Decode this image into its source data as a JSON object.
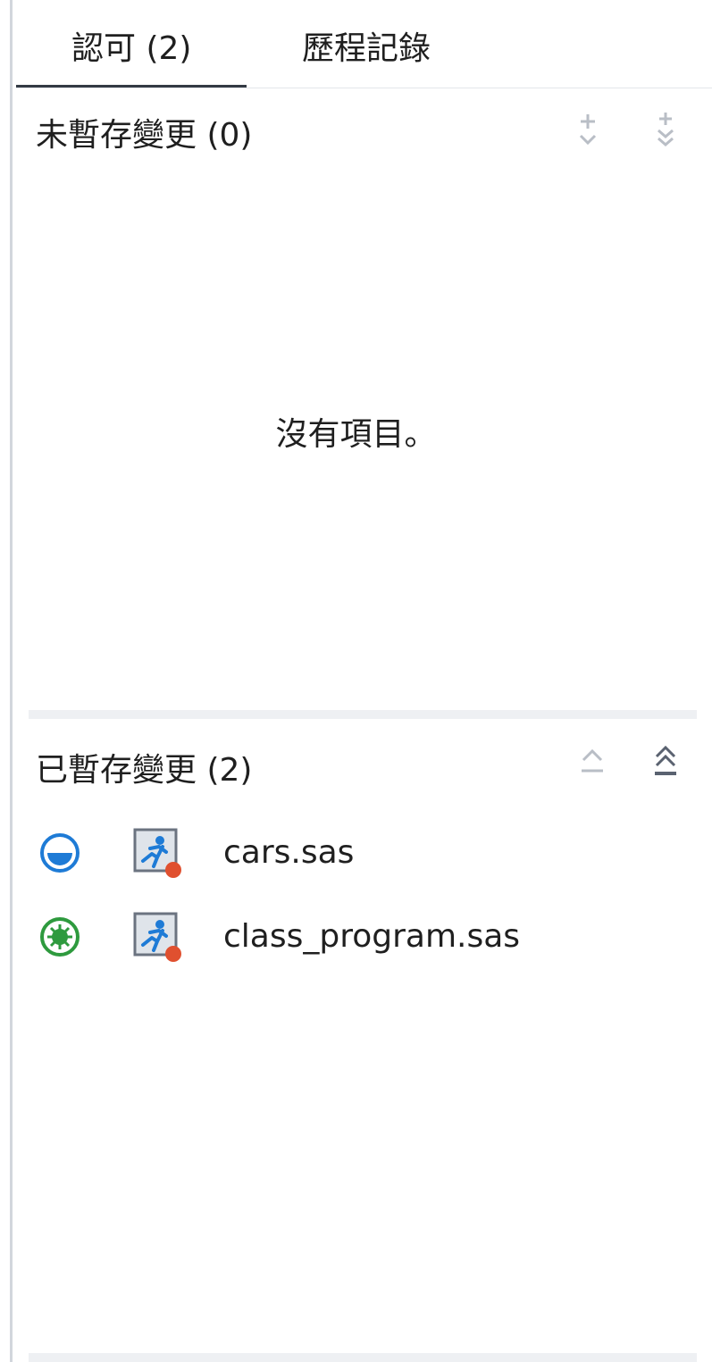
{
  "tabs": [
    {
      "label": "認可 (2)",
      "active": true
    },
    {
      "label": "歷程記錄",
      "active": false
    }
  ],
  "unstaged": {
    "title": "未暫存變更 (0)",
    "empty_message": "沒有項目。",
    "actions": [
      "stage-icon",
      "stage-all-icon"
    ]
  },
  "staged": {
    "title": "已暫存變更 (2)",
    "actions": [
      "unstage-icon",
      "unstage-all-icon"
    ],
    "files": [
      {
        "name": "cars.sas",
        "status_icon": "modified-status-icon",
        "status_color": "#1e7bd6",
        "file_icon": "sas-program-icon"
      },
      {
        "name": "class_program.sas",
        "status_icon": "added-status-icon",
        "status_color": "#2e9a3e",
        "file_icon": "sas-program-icon"
      }
    ]
  },
  "colors": {
    "accent_underline": "#333a44",
    "divider": "#eef0f3",
    "icon_disabled": "#b9bec6",
    "icon_enabled": "#5a6270",
    "file_icon_badge": "#e0502f"
  }
}
